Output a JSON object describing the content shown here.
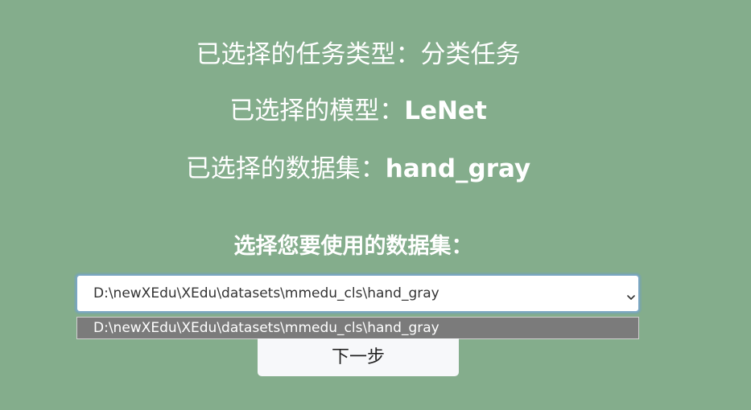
{
  "summary": {
    "task_label": "已选择的任务类型：",
    "task_value": "分类任务",
    "model_label": "已选择的模型：",
    "model_value": "LeNet",
    "dataset_label": "已选择的数据集：",
    "dataset_value": "hand_gray"
  },
  "chooser": {
    "heading": "选择您要使用的数据集：",
    "selected_value": "D:\\newXEdu\\XEdu\\datasets\\mmedu_cls\\hand_gray",
    "options": [
      "D:\\newXEdu\\XEdu\\datasets\\mmedu_cls\\hand_gray"
    ]
  },
  "actions": {
    "next_label": "下一步"
  },
  "colors": {
    "background": "#84ad8c",
    "option_highlight": "#7b7b7b"
  },
  "icons": {
    "dropdown": "chevron-down-icon"
  }
}
